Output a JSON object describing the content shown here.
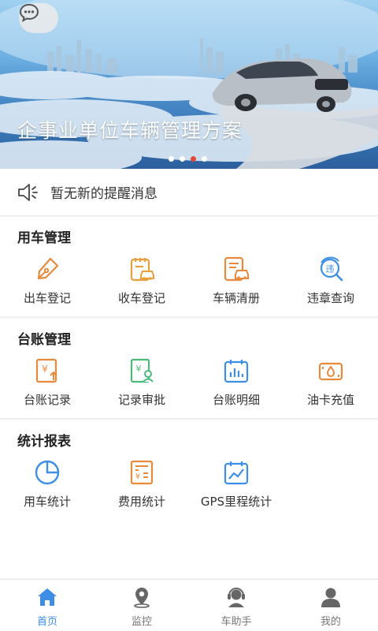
{
  "banner": {
    "title": "企事业单位车辆管理方案",
    "dots": 4,
    "active_dot": 3
  },
  "notice": {
    "text": "暂无新的提醒消息"
  },
  "sections": [
    {
      "title": "用车管理",
      "items": [
        {
          "label": "出车登记",
          "icon": "pen-icon"
        },
        {
          "label": "收车登记",
          "icon": "car-clipboard-icon"
        },
        {
          "label": "车辆清册",
          "icon": "car-list-icon"
        },
        {
          "label": "违章查询",
          "icon": "violation-search-icon"
        }
      ]
    },
    {
      "title": "台账管理",
      "items": [
        {
          "label": "台账记录",
          "icon": "ledger-record-icon"
        },
        {
          "label": "记录审批",
          "icon": "approval-icon"
        },
        {
          "label": "台账明细",
          "icon": "ledger-detail-icon"
        },
        {
          "label": "油卡充值",
          "icon": "fuel-card-icon"
        }
      ]
    },
    {
      "title": "统计报表",
      "items": [
        {
          "label": "用车统计",
          "icon": "pie-chart-icon"
        },
        {
          "label": "费用统计",
          "icon": "expense-icon"
        },
        {
          "label": "GPS里程统计",
          "icon": "trend-calendar-icon"
        }
      ]
    }
  ],
  "tabbar": [
    {
      "label": "首页",
      "icon": "home-icon",
      "active": true
    },
    {
      "label": "监控",
      "icon": "location-icon",
      "active": false
    },
    {
      "label": "车助手",
      "icon": "assistant-icon",
      "active": false
    },
    {
      "label": "我的",
      "icon": "user-icon",
      "active": false
    }
  ],
  "colors": {
    "accent": "#3c8ee6",
    "orange": "#e88a3c",
    "green": "#4cb87a",
    "active_dot": "#e34a3a"
  }
}
